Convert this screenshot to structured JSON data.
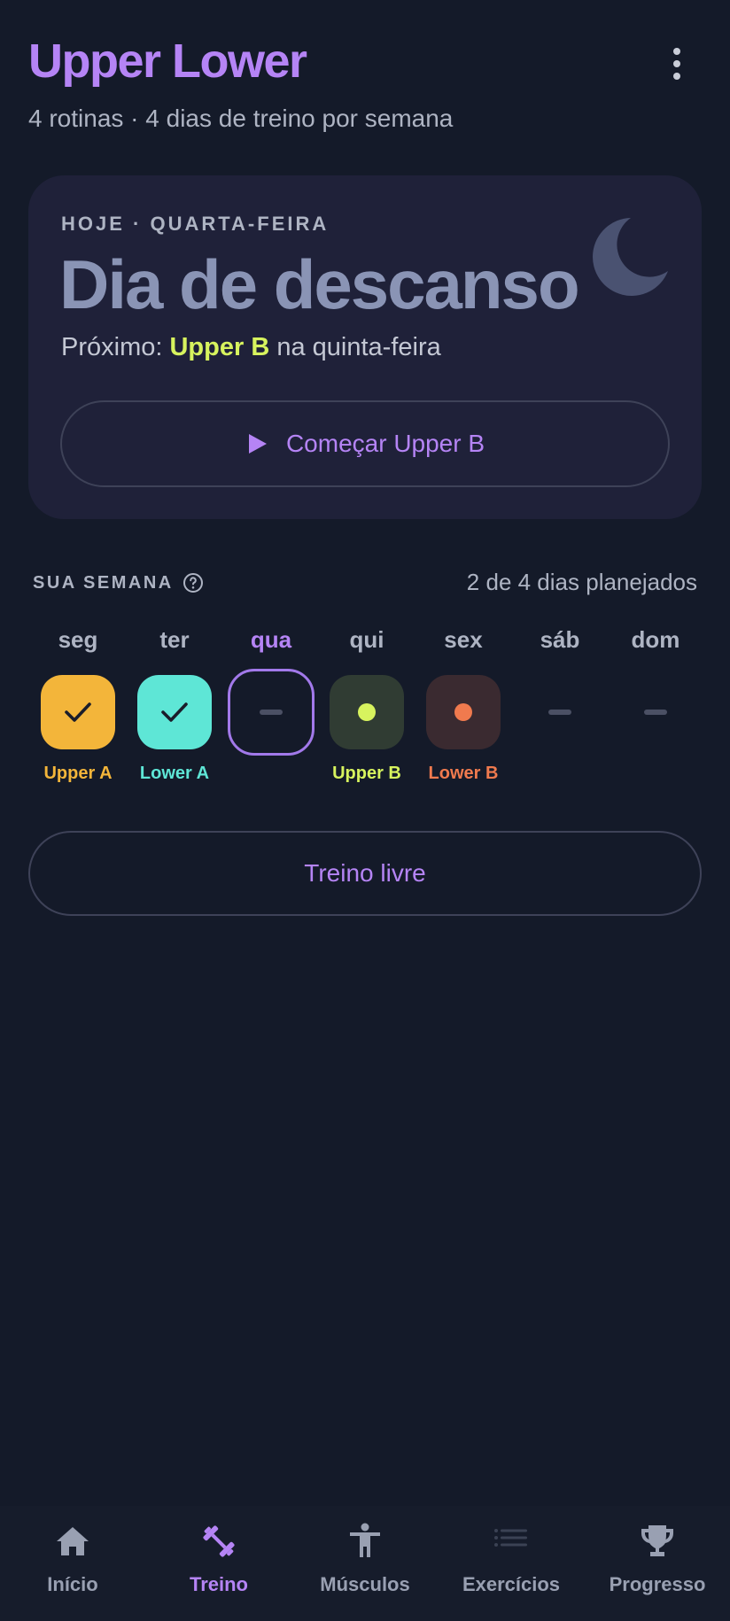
{
  "header": {
    "title": "Upper Lower",
    "subtitle": "4 rotinas · 4 dias de treino por semana"
  },
  "today": {
    "kicker": "HOJE · QUARTA-FEIRA",
    "heading": "Dia de descanso",
    "next_prefix": "Próximo: ",
    "next_routine": "Upper B",
    "next_suffix": " na quinta-feira",
    "start_label": "Começar Upper B"
  },
  "week": {
    "label": "SUA SEMANA",
    "status": "2 de 4 dias planejados",
    "days": [
      {
        "name": "seg",
        "routine": "Upper A",
        "state": "done",
        "color": "#f3b53a"
      },
      {
        "name": "ter",
        "routine": "Lower A",
        "state": "done",
        "color": "#5ee6d6"
      },
      {
        "name": "qua",
        "routine": "",
        "state": "today",
        "color": "#a279ea"
      },
      {
        "name": "qui",
        "routine": "Upper B",
        "state": "planned",
        "color": "#d7f35e"
      },
      {
        "name": "sex",
        "routine": "Lower B",
        "state": "planned",
        "color": "#f07a4e"
      },
      {
        "name": "sáb",
        "routine": "",
        "state": "rest",
        "color": ""
      },
      {
        "name": "dom",
        "routine": "",
        "state": "rest",
        "color": ""
      }
    ]
  },
  "free_workout_label": "Treino livre",
  "nav": {
    "items": [
      {
        "label": "Início",
        "icon": "home-icon"
      },
      {
        "label": "Treino",
        "icon": "dumbbell-icon",
        "active": true
      },
      {
        "label": "Músculos",
        "icon": "body-icon"
      },
      {
        "label": "Exercícios",
        "icon": "list-icon"
      },
      {
        "label": "Progresso",
        "icon": "trophy-icon"
      }
    ]
  },
  "colors": {
    "accent": "#b584f5",
    "background": "#141a29",
    "card": "#1f2139",
    "highlight": "#d7f35e"
  }
}
